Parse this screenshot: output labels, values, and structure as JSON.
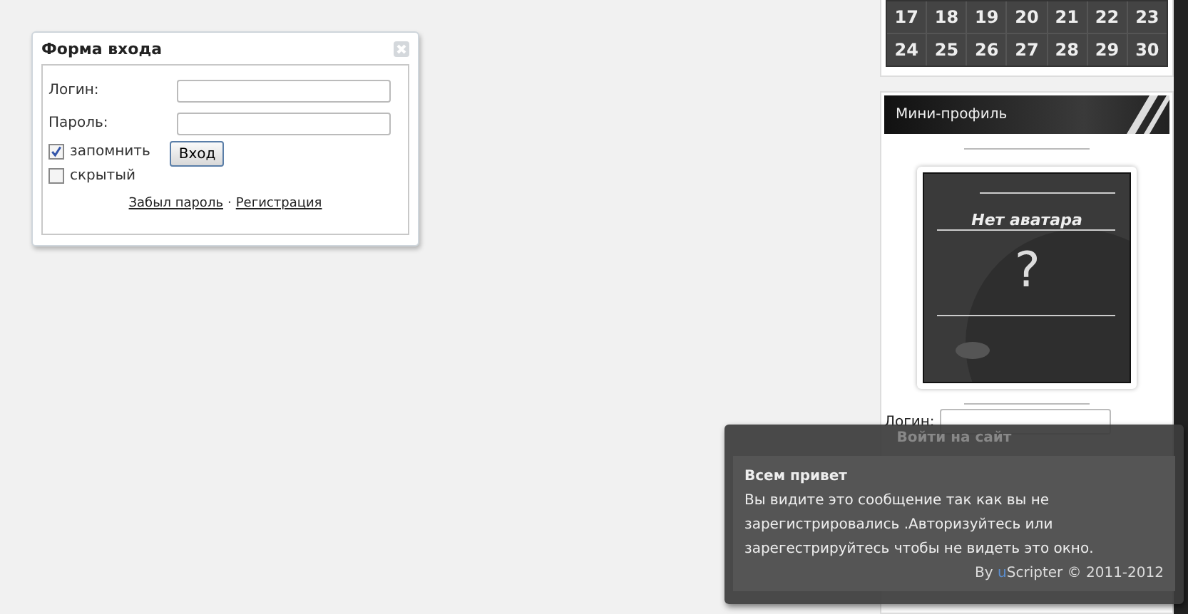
{
  "login_form": {
    "title": "Форма входа",
    "login_label": "Логин:",
    "password_label": "Пароль:",
    "options": [
      {
        "label": "запомнить",
        "checked": true
      },
      {
        "label": "скрытый",
        "checked": false
      }
    ],
    "submit": "Вход",
    "links": [
      "Забыл пароль",
      "Регистрация"
    ],
    "link_separator": "·"
  },
  "calendar": {
    "weeks": [
      [
        "17",
        "18",
        "19",
        "20",
        "21",
        "22",
        "23"
      ],
      [
        "24",
        "25",
        "26",
        "27",
        "28",
        "29",
        "30"
      ]
    ]
  },
  "mini_profile": {
    "title": "Мини-профиль",
    "avatar_caption": "Нет аватара",
    "avatar_mark": "?",
    "login_label": "Логин:"
  },
  "popup": {
    "title": "Войти на сайт",
    "heading": "Всем привет",
    "message": "Вы видите это сообщение так как вы не зарегистрировались .Авторизуйтесь или зарегестрируйтесь чтобы не видеть это окно.",
    "credit": {
      "before": "By ",
      "accent": "u",
      "after": "Scripter © 2011-2012"
    }
  }
}
